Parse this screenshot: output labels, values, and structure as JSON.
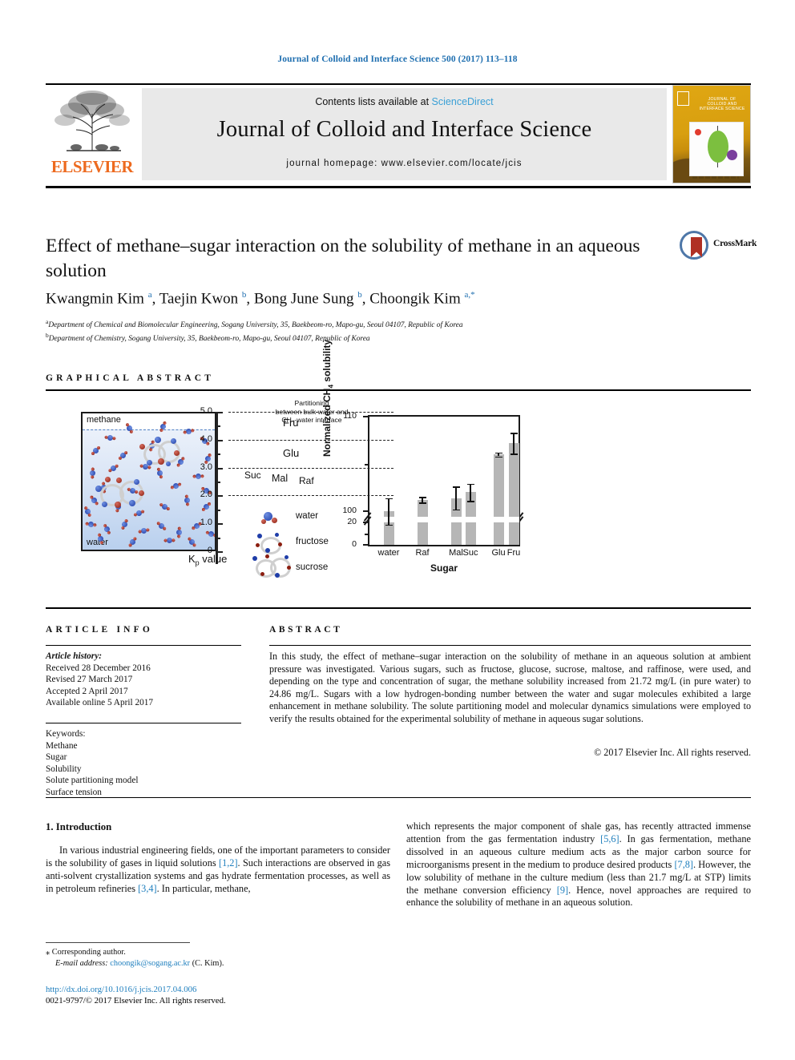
{
  "running_head": "Journal of Colloid and Interface Science 500 (2017) 113–118",
  "masthead": {
    "contents_prefix": "Contents lists available at ",
    "sciencedirect": "ScienceDirect",
    "journal_name": "Journal of Colloid and Interface Science",
    "homepage": "journal homepage: www.elsevier.com/locate/jcis",
    "publisher": "ELSEVIER",
    "cover_title": "JOURNAL OF COLLOID AND INTERFACE SCIENCE"
  },
  "article": {
    "title": "Effect of methane–sugar interaction on the solubility of methane in an aqueous solution",
    "crossmark_label": "CrossMark",
    "authors_html": "Kwangmin Kim <sup>a</sup>, Taejin Kwon <sup>b</sup>, Bong June Sung <sup>b</sup>, Choongik Kim <sup>a,*</sup>",
    "affiliation_a": "Department of Chemical and Biomolecular Engineering, Sogang University, 35, Baekbeom-ro, Mapo-gu, Seoul 04107, Republic of Korea",
    "affiliation_b": "Department of Chemistry, Sogang University, 35, Baekbeom-ro, Mapo-gu, Seoul 04107, Republic of Korea"
  },
  "graphical_abstract": {
    "heading": "GRAPHICAL ABSTRACT",
    "panel_labels": {
      "top": "methane",
      "bottom": "water"
    },
    "kp_title_lines": [
      "Partitioning",
      "between bulk water and",
      "CH₄-water interface"
    ],
    "kp_axis_label": "K",
    "kp_axis_sub": "p",
    "kp_axis_suffix": " value",
    "kp_ticks": [
      "5.0",
      "4.0",
      "3.0",
      "2.0",
      "1.0",
      "0"
    ],
    "kp_markers": [
      {
        "name": "Fru",
        "value": 4.6
      },
      {
        "name": "Glu",
        "value": 3.5
      },
      {
        "name": "Suc",
        "value": 2.7
      },
      {
        "name": "Mal",
        "value": 2.6
      },
      {
        "name": "Raf",
        "value": 2.5
      }
    ],
    "legend": [
      {
        "label": "water"
      },
      {
        "label": "fructose"
      },
      {
        "label": "sucrose"
      }
    ]
  },
  "chart_data": {
    "type": "bar",
    "title": "",
    "xlabel": "Sugar",
    "ylabel": "Normalized CH₄ solubility",
    "categories": [
      "water",
      "Raf",
      "Mal",
      "Suc",
      "Glu",
      "Fru"
    ],
    "values": [
      100.0,
      101.2,
      101.4,
      102.0,
      106.0,
      107.2
    ],
    "errors": [
      1.4,
      0.3,
      1.2,
      0.9,
      0.2,
      1.1
    ],
    "ytick_labels": [
      "110",
      "100",
      "20",
      "0"
    ],
    "ylim": [
      0,
      110
    ],
    "axis_break": true,
    "break_note": "y-axis broken between 20 and 100",
    "grid": false,
    "legend": "none",
    "bar_color": "#b6b6b6"
  },
  "article_info": {
    "heading": "ARTICLE INFO",
    "history_label": "Article history:",
    "history": [
      "Received 28 December 2016",
      "Revised 27 March 2017",
      "Accepted 2 April 2017",
      "Available online 5 April 2017"
    ],
    "keywords_label": "Keywords:",
    "keywords": [
      "Methane",
      "Sugar",
      "Solubility",
      "Solute partitioning model",
      "Surface tension"
    ]
  },
  "abstract": {
    "heading": "ABSTRACT",
    "text": "In this study, the effect of methane–sugar interaction on the solubility of methane in an aqueous solution at ambient pressure was investigated. Various sugars, such as fructose, glucose, sucrose, maltose, and raffinose, were used, and depending on the type and concentration of sugar, the methane solubility increased from 21.72 mg/L (in pure water) to 24.86 mg/L. Sugars with a low hydrogen-bonding number between the water and sugar molecules exhibited a large enhancement in methane solubility. The solute partitioning model and molecular dynamics simulations were employed to verify the results obtained for the experimental solubility of methane in aqueous sugar solutions.",
    "copyright": "© 2017 Elsevier Inc. All rights reserved."
  },
  "introduction": {
    "heading": "1. Introduction",
    "left_parts": [
      "In various industrial engineering fields, one of the important parameters to consider is the solubility of gases in liquid solutions ",
      "[1,2]",
      ". Such interactions are observed in gas anti-solvent crystallization systems and gas hydrate fermentation processes, as well as in petroleum refineries ",
      "[3,4]",
      ". In particular, methane,"
    ],
    "right_parts": [
      "which represents the major component of shale gas, has recently attracted immense attention from the gas fermentation industry ",
      "[5,6]",
      ". In gas fermentation, methane dissolved in an aqueous culture medium acts as the major carbon source for microorganisms present in the medium to produce desired products ",
      "[7,8]",
      ". However, the low solubility of methane in the culture medium (less than 21.7 mg/L at STP) limits the methane conversion efficiency ",
      "[9]",
      ". Hence, novel approaches are required to enhance the solubility of methane in an aqueous solution."
    ]
  },
  "footer": {
    "corresponding_marker": "⁎",
    "corresponding_label": "Corresponding author.",
    "email_label": "E-mail address:",
    "email": "choongik@sogang.ac.kr",
    "email_owner": "(C. Kim).",
    "doi_url": "http://dx.doi.org/10.1016/j.jcis.2017.04.006",
    "issn_line_prefix": "0021-9797/",
    "issn_line_rest": "© 2017 Elsevier Inc. All rights reserved."
  }
}
